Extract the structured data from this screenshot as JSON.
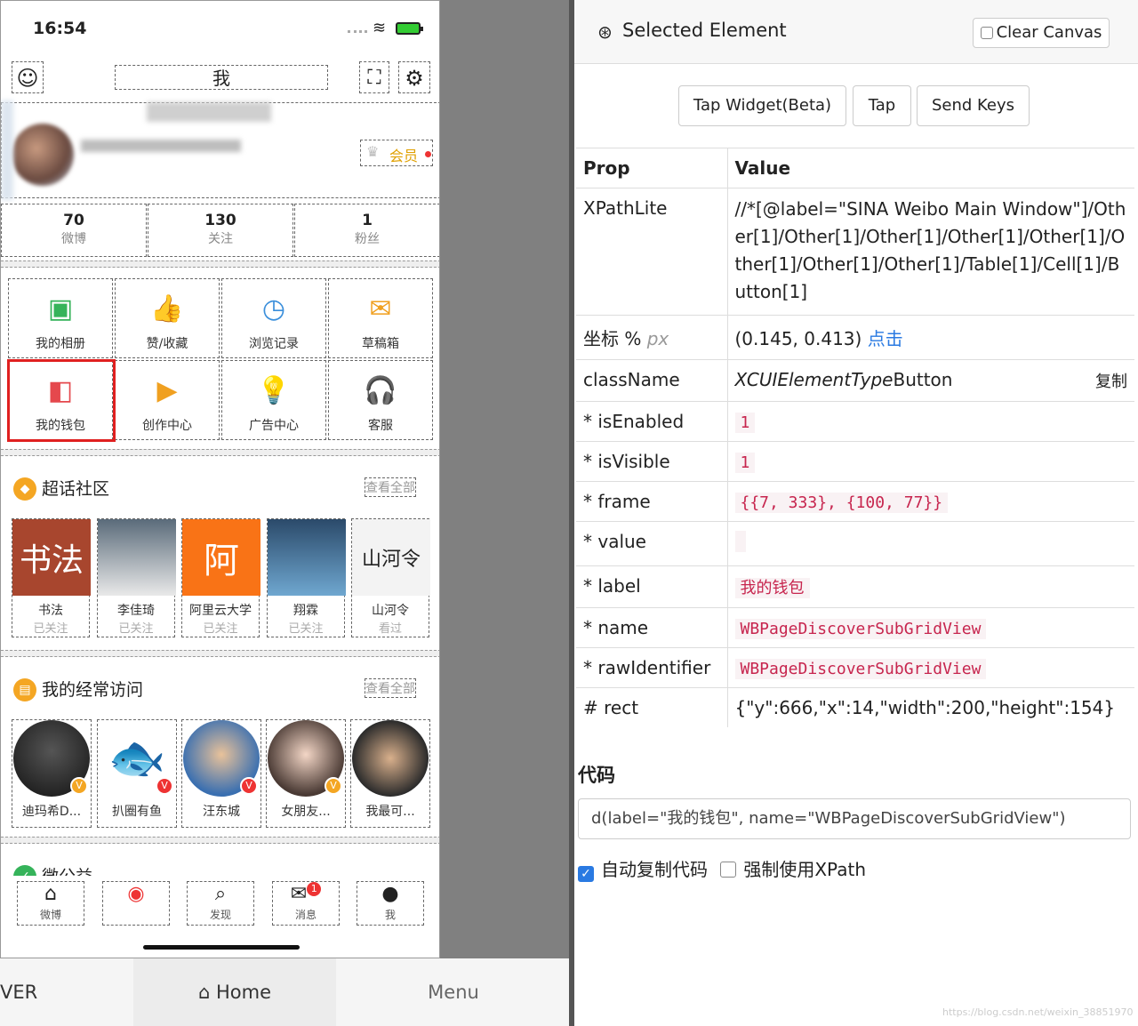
{
  "phone": {
    "status_time": "16:54",
    "nav_title": "我",
    "vip_label": "会员",
    "stats": [
      {
        "num": "70",
        "label": "微博"
      },
      {
        "num": "130",
        "label": "关注"
      },
      {
        "num": "1",
        "label": "粉丝"
      }
    ],
    "grid": [
      {
        "label": "我的相册",
        "icon": "▣",
        "color": "#35b35a"
      },
      {
        "label": "赞/收藏",
        "icon": "👍",
        "color": "#e5484d"
      },
      {
        "label": "浏览记录",
        "icon": "◷",
        "color": "#3b8fdb"
      },
      {
        "label": "草稿箱",
        "icon": "✉",
        "color": "#f0a020"
      },
      {
        "label": "我的钱包",
        "icon": "◧",
        "color": "#e5484d"
      },
      {
        "label": "创作中心",
        "icon": "▶",
        "color": "#f0a020"
      },
      {
        "label": "广告中心",
        "icon": "💡",
        "color": "#f0c020"
      },
      {
        "label": "客服",
        "icon": "🎧",
        "color": "#35b35a"
      }
    ],
    "supertopic": {
      "title": "超话社区",
      "more": "查看全部",
      "items": [
        {
          "name": "书法",
          "sub": "已关注",
          "img_text": "书法"
        },
        {
          "name": "李佳琦",
          "sub": "已关注",
          "img_text": ""
        },
        {
          "name": "阿里云大学",
          "sub": "已关注",
          "img_text": "阿"
        },
        {
          "name": "翔霖",
          "sub": "已关注",
          "img_text": ""
        },
        {
          "name": "山河令",
          "sub": "看过",
          "img_text": "山河令"
        }
      ]
    },
    "frequent": {
      "title": "我的经常访问",
      "more": "查看全部",
      "items": [
        {
          "name": "迪玛希D..."
        },
        {
          "name": "扒圈有鱼"
        },
        {
          "name": "汪东城"
        },
        {
          "name": "女朋友..."
        },
        {
          "name": "我最可..."
        }
      ]
    },
    "next_section": "微公益",
    "tabs": [
      {
        "label": "微博",
        "icon": "⌂"
      },
      {
        "label": "",
        "icon": "◉"
      },
      {
        "label": "发现",
        "icon": "⌕"
      },
      {
        "label": "消息",
        "icon": "✉"
      },
      {
        "label": "我",
        "icon": "●"
      }
    ],
    "message_badge": "1"
  },
  "bottombar": {
    "ver": "VER",
    "home": "Home",
    "menu": "Menu"
  },
  "panel": {
    "title": "Selected Element",
    "clear_canvas": "Clear Canvas",
    "buttons": [
      "Tap Widget(Beta)",
      "Tap",
      "Send Keys"
    ],
    "table_header": {
      "prop": "Prop",
      "value": "Value"
    },
    "xpath_key": "XPathLite",
    "xpath_value": "//*[@label=\"SINA Weibo Main Window\"]/Other[1]/Other[1]/Other[1]/Other[1]/Other[1]/Other[1]/Other[1]/Other[1]/Table[1]/Cell[1]/Button[1]",
    "coord_key": "坐标 %",
    "coord_unit": "px",
    "coord_value": "(0.145, 0.413)",
    "coord_action": "点击",
    "classname_key": "className",
    "classname_prefix": "XCUIElementType",
    "classname_suffix": "Button",
    "copy_label": "复制",
    "isEnabled_key": "* isEnabled",
    "isEnabled": "1",
    "isVisible_key": "* isVisible",
    "isVisible": "1",
    "frame_key": "* frame",
    "frame": "{{7, 333}, {100, 77}}",
    "value_key": "* value",
    "value": "",
    "label_key": "* label",
    "label": "我的钱包",
    "name_key": "* name",
    "name": "WBPageDiscoverSubGridView",
    "rawid_key": "* rawIdentifier",
    "rawIdentifier": "WBPageDiscoverSubGridView",
    "rect_key": "# rect",
    "rect": "{\"y\":666,\"x\":14,\"width\":200,\"height\":154}",
    "code_heading": "代码",
    "code": "d(label=\"我的钱包\", name=\"WBPageDiscoverSubGridView\")",
    "auto_copy_label": "自动复制代码",
    "auto_copy_checked": true,
    "force_xpath_label": "强制使用XPath",
    "force_xpath_checked": false
  },
  "watermark": "https://blog.csdn.net/weixin_38851970"
}
